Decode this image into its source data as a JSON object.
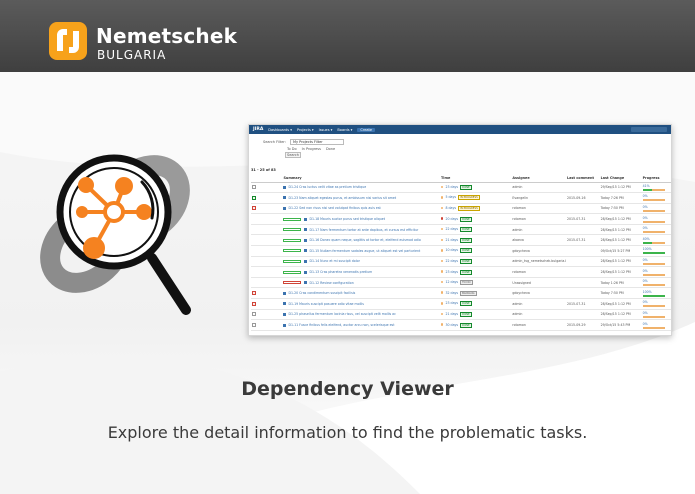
{
  "brand": {
    "name": "Nemetschek",
    "sub": "BULGARIA"
  },
  "colors": {
    "header": "#4a4a4a",
    "logo_orange": "#f7a21b",
    "jira_blue": "#205081",
    "accent": "#f58220"
  },
  "illustration": {
    "icon": "magnifier-dependency-icon"
  },
  "screenshot": {
    "topbar": {
      "logo": "JIRA",
      "menus": [
        "Dashboards ▾",
        "Projects ▾",
        "Issues ▾",
        "Boards ▾"
      ],
      "create": "Create",
      "search": "Search"
    },
    "filter": {
      "label": "Search Filter:",
      "value": "My Projects Filter",
      "options": [
        "To Do",
        "In Progress",
        "Done"
      ],
      "button": "Search"
    },
    "count": "31 - 25 of 83",
    "columns": [
      "",
      "Summary",
      "Time",
      "Assignee",
      "Last comment",
      "Last Change",
      "Progress"
    ],
    "rows": [
      {
        "summary": "D1-24 Cras luctus velit vitae as pretium tristique",
        "time": "23 days",
        "tag": "DONE",
        "assignee": "admin",
        "comment": "",
        "change": "29/Sep/15 1:12 PM",
        "progress": "41%"
      },
      {
        "summary": "D1-23 Nam aliquet egestas purus, et ambissum nisi varius sit amet",
        "time": "5 days",
        "tag": "IN PROGRESS",
        "assignee": "Evangelin",
        "comment": "2015-09-16",
        "change": "Today 7:26 PM",
        "progress": "0%"
      },
      {
        "summary": "D1-22 Sed non risus nisi sed volutpat finibus quis auis est",
        "time": "8 days",
        "tag": "IN PROGRESS",
        "assignee": "rotomon",
        "comment": "",
        "change": "Today 7:50 PM",
        "progress": "0%"
      },
      {
        "summary": "D1-18 Mauris auctor purus sed tristique aliquet",
        "time": "20 days",
        "tag": "DONE",
        "assignee": "rotomon",
        "comment": "2015-07-31",
        "change": "28/Sep/15 1:12 PM",
        "progress": "0%"
      },
      {
        "summary": "D1-17 Nam fermentum tortor at ante dapibus, et cursus est efficitur",
        "time": "22 days",
        "tag": "DONE",
        "assignee": "admin",
        "comment": "",
        "change": "28/Sep/15 1:12 PM",
        "progress": "0%"
      },
      {
        "summary": "D1-16 Donec quam neque, sagittis at tortor et, eleifend euismod odio",
        "time": "21 days",
        "tag": "DONE",
        "assignee": "akoeva",
        "comment": "2015-07-31",
        "change": "28/Sep/15 1:12 PM",
        "progress": "40%"
      },
      {
        "summary": "D1-15 Nullam fermentum sodales augue, ut aliquet est vel parturient",
        "time": "10 days",
        "tag": "DONE",
        "assignee": "gdoycheva",
        "comment": "",
        "change": "09/Oct/15 5:27 PM",
        "progress": "100%"
      },
      {
        "summary": "D1-14 Nunc et mi suscipit dolor",
        "time": "22 days",
        "tag": "DONE",
        "assignee": "admin_tvg_nemetschek.bulgaria.bgnet",
        "comment": "",
        "change": "28/Sep/15 1:12 PM",
        "progress": "0%"
      },
      {
        "summary": "D1-13 Cras pharetra venenatis pretium",
        "time": "23 days",
        "tag": "DONE",
        "assignee": "rotomon",
        "comment": "",
        "change": "28/Sep/15 1:12 PM",
        "progress": "0%"
      },
      {
        "summary": "D1-12 Review configuration",
        "time": "12 days",
        "tag": "TO DO",
        "assignee": "Unassigned",
        "comment": "",
        "change": "Today 1:26 PM",
        "progress": "0%"
      },
      {
        "summary": "D1-20 Cras condimentum suscipit facilisis",
        "time": "32 days",
        "tag": "BACKLOG",
        "assignee": "gdoycheva",
        "comment": "",
        "change": "Today 7:50 PM",
        "progress": "100%"
      },
      {
        "summary": "D1-19 Mauris suscipit posuere odio vitae mollis",
        "time": "23 days",
        "tag": "DONE",
        "assignee": "admin",
        "comment": "2015-07-31",
        "change": "28/Sep/15 1:12 PM",
        "progress": "0%"
      },
      {
        "summary": "D1-25 phasellus fermentum lacinia risus, vel suscipit velit mollis ac",
        "time": "21 days",
        "tag": "DONE",
        "assignee": "admin",
        "comment": "",
        "change": "28/Sep/15 1:12 PM",
        "progress": "0%"
      },
      {
        "summary": "D1-11 Fusce finibus felis eleifend, auctor arcu non, scelerisque est",
        "time": "30 days",
        "tag": "DONE",
        "assignee": "rotomon",
        "comment": "2015-09-29",
        "change": "29/Oct/15 5:43 PM",
        "progress": "0%"
      }
    ]
  },
  "title": "Dependency Viewer",
  "subtitle": "Explore the detail information to find the problematic tasks."
}
